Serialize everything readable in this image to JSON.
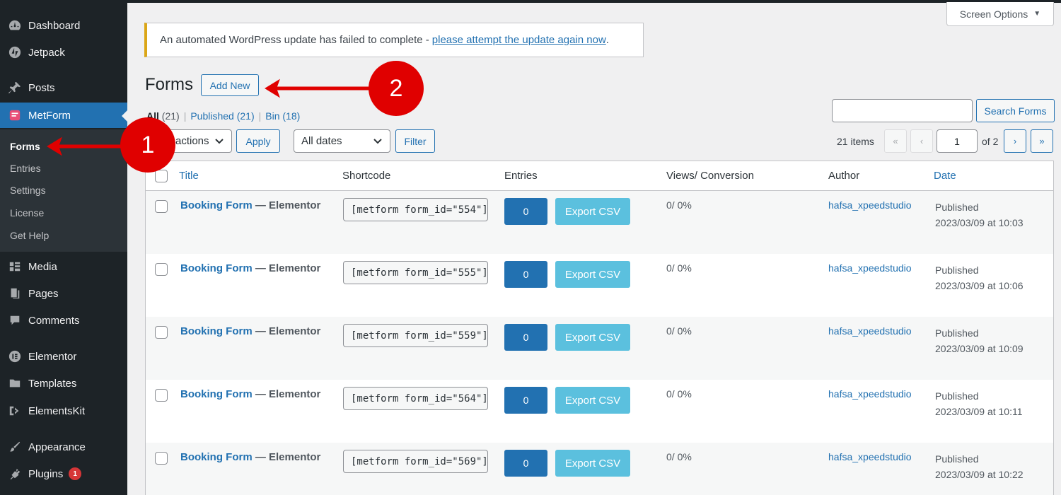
{
  "sidebar": {
    "items": [
      {
        "label": "Dashboard",
        "icon": "dashboard-icon"
      },
      {
        "label": "Jetpack",
        "icon": "jetpack-icon"
      },
      {
        "label": "Posts",
        "icon": "pin-icon"
      },
      {
        "label": "MetForm",
        "icon": "metform-icon"
      },
      {
        "label": "Media",
        "icon": "media-icon"
      },
      {
        "label": "Pages",
        "icon": "pages-icon"
      },
      {
        "label": "Comments",
        "icon": "comment-icon"
      },
      {
        "label": "Elementor",
        "icon": "elementor-icon"
      },
      {
        "label": "Templates",
        "icon": "folder-icon"
      },
      {
        "label": "ElementsKit",
        "icon": "elementskit-icon"
      },
      {
        "label": "Appearance",
        "icon": "brush-icon"
      },
      {
        "label": "Plugins",
        "icon": "plugin-icon",
        "badge": "1"
      }
    ],
    "submenu": [
      "Forms",
      "Entries",
      "Settings",
      "License",
      "Get Help"
    ]
  },
  "screen_options": "Screen Options",
  "notice": {
    "text": "An automated WordPress update has failed to complete -",
    "link": "please attempt the update again now",
    "end": "."
  },
  "page": {
    "title": "Forms",
    "add_new": "Add New"
  },
  "filters": {
    "all": "All",
    "all_count": "(21)",
    "published": "Published",
    "published_count": "(21)",
    "bin": "Bin",
    "bin_count": "(18)",
    "bulk_actions": "actions",
    "apply": "Apply",
    "dates": "All dates",
    "filter": "Filter"
  },
  "search": {
    "button": "Search Forms"
  },
  "pagination": {
    "count": "21 items",
    "first": "«",
    "prev": "‹",
    "current": "1",
    "of": "of 2",
    "next": "›",
    "last": "»"
  },
  "table": {
    "columns": [
      "Title",
      "Shortcode",
      "Entries",
      "Views/ Conversion",
      "Author",
      "Date"
    ],
    "rows": [
      {
        "title": "Booking Form",
        "suffix": " — Elementor",
        "shortcode": "[metform form_id=\"554\"]",
        "entries": "0",
        "export": "Export CSV",
        "views": "0/ 0%",
        "author": "hafsa_xpeedstudio",
        "status": "Published",
        "date": "2023/03/09 at 10:03"
      },
      {
        "title": "Booking Form",
        "suffix": " — Elementor",
        "shortcode": "[metform form_id=\"555\"]",
        "entries": "0",
        "export": "Export CSV",
        "views": "0/ 0%",
        "author": "hafsa_xpeedstudio",
        "status": "Published",
        "date": "2023/03/09 at 10:06"
      },
      {
        "title": "Booking Form",
        "suffix": " — Elementor",
        "shortcode": "[metform form_id=\"559\"]",
        "entries": "0",
        "export": "Export CSV",
        "views": "0/ 0%",
        "author": "hafsa_xpeedstudio",
        "status": "Published",
        "date": "2023/03/09 at 10:09"
      },
      {
        "title": "Booking Form",
        "suffix": " — Elementor",
        "shortcode": "[metform form_id=\"564\"]",
        "entries": "0",
        "export": "Export CSV",
        "views": "0/ 0%",
        "author": "hafsa_xpeedstudio",
        "status": "Published",
        "date": "2023/03/09 at 10:11"
      },
      {
        "title": "Booking Form",
        "suffix": " — Elementor",
        "shortcode": "[metform form_id=\"569\"]",
        "entries": "0",
        "export": "Export CSV",
        "views": "0/ 0%",
        "author": "hafsa_xpeedstudio",
        "status": "Published",
        "date": "2023/03/09 at 10:22"
      }
    ]
  },
  "annotations": {
    "marker_1": "1",
    "marker_2": "2",
    "color": "#e00000"
  },
  "colors": {
    "accent": "#2271b1",
    "sidebar": "#1d2327",
    "export": "#5bc0de"
  }
}
